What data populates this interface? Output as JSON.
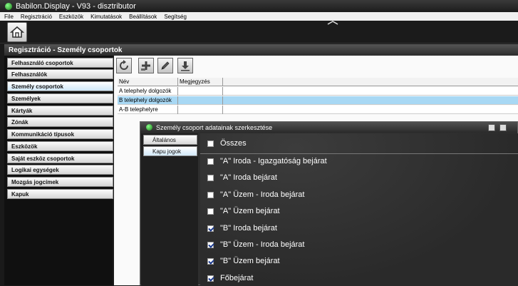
{
  "window": {
    "title": "Babilon.Display - V93 - disztributor"
  },
  "menubar": [
    "File",
    "Regisztráció",
    "Eszközök",
    "Kimutatások",
    "Beállítások",
    "Segítség"
  ],
  "toolbar": {
    "home_icon": "home-icon"
  },
  "section": {
    "title": "Regisztráció - Személy csoportok"
  },
  "sidebar": {
    "items": [
      {
        "label": "Felhasználó csoportok",
        "active": false
      },
      {
        "label": "Felhasználók",
        "active": false
      },
      {
        "label": "Személy csoportok",
        "active": true
      },
      {
        "label": "Személyek",
        "active": false
      },
      {
        "label": "Kártyák",
        "active": false
      },
      {
        "label": "Zónák",
        "active": false
      },
      {
        "label": "Kommunikáció típusok",
        "active": false
      },
      {
        "label": "Eszközök",
        "active": false
      },
      {
        "label": "Saját eszköz csoportok",
        "active": false
      },
      {
        "label": "Logikai egységek",
        "active": false
      },
      {
        "label": "Mozgás jogcímek",
        "active": false
      },
      {
        "label": "Kapuk",
        "active": false
      }
    ]
  },
  "main_toolbar": {
    "buttons": [
      {
        "name": "refresh-button",
        "icon": "refresh-icon"
      },
      {
        "name": "add-button",
        "icon": "add-icon"
      },
      {
        "name": "edit-button",
        "icon": "edit-icon"
      },
      {
        "name": "download-button",
        "icon": "download-icon"
      }
    ]
  },
  "table": {
    "columns": [
      "Név",
      "Megjegyzés"
    ],
    "rows": [
      {
        "name": "A telephely dolgozók",
        "note": "",
        "selected": false
      },
      {
        "name": "B telephely dolgozók",
        "note": "",
        "selected": true
      },
      {
        "name": "A-B telephelyre",
        "note": "",
        "selected": false
      }
    ]
  },
  "dialog": {
    "title": "Személy csoport adatainak szerkesztése",
    "tabs": [
      {
        "label": "Általános",
        "active": false
      },
      {
        "label": "Kapu jogok",
        "active": true
      }
    ],
    "all_label": "Összes",
    "all_checked": false,
    "permissions": [
      {
        "label": "\"A\" Iroda - Igazgatóság bejárat",
        "checked": false
      },
      {
        "label": "\"A\" Iroda bejárat",
        "checked": false
      },
      {
        "label": "\"A\" Üzem - Iroda bejárat",
        "checked": false
      },
      {
        "label": "\"A\" Üzem bejárat",
        "checked": false
      },
      {
        "label": "\"B\" Iroda bejárat",
        "checked": true
      },
      {
        "label": "\"B\" Üzem - Iroda bejárat",
        "checked": true
      },
      {
        "label": "\"B\" Üzem bejárat",
        "checked": true
      },
      {
        "label": "Főbejárat",
        "checked": true
      }
    ]
  },
  "colors": {
    "selected_row": "#a8d8f4",
    "accent_green": "#2aa82a"
  }
}
